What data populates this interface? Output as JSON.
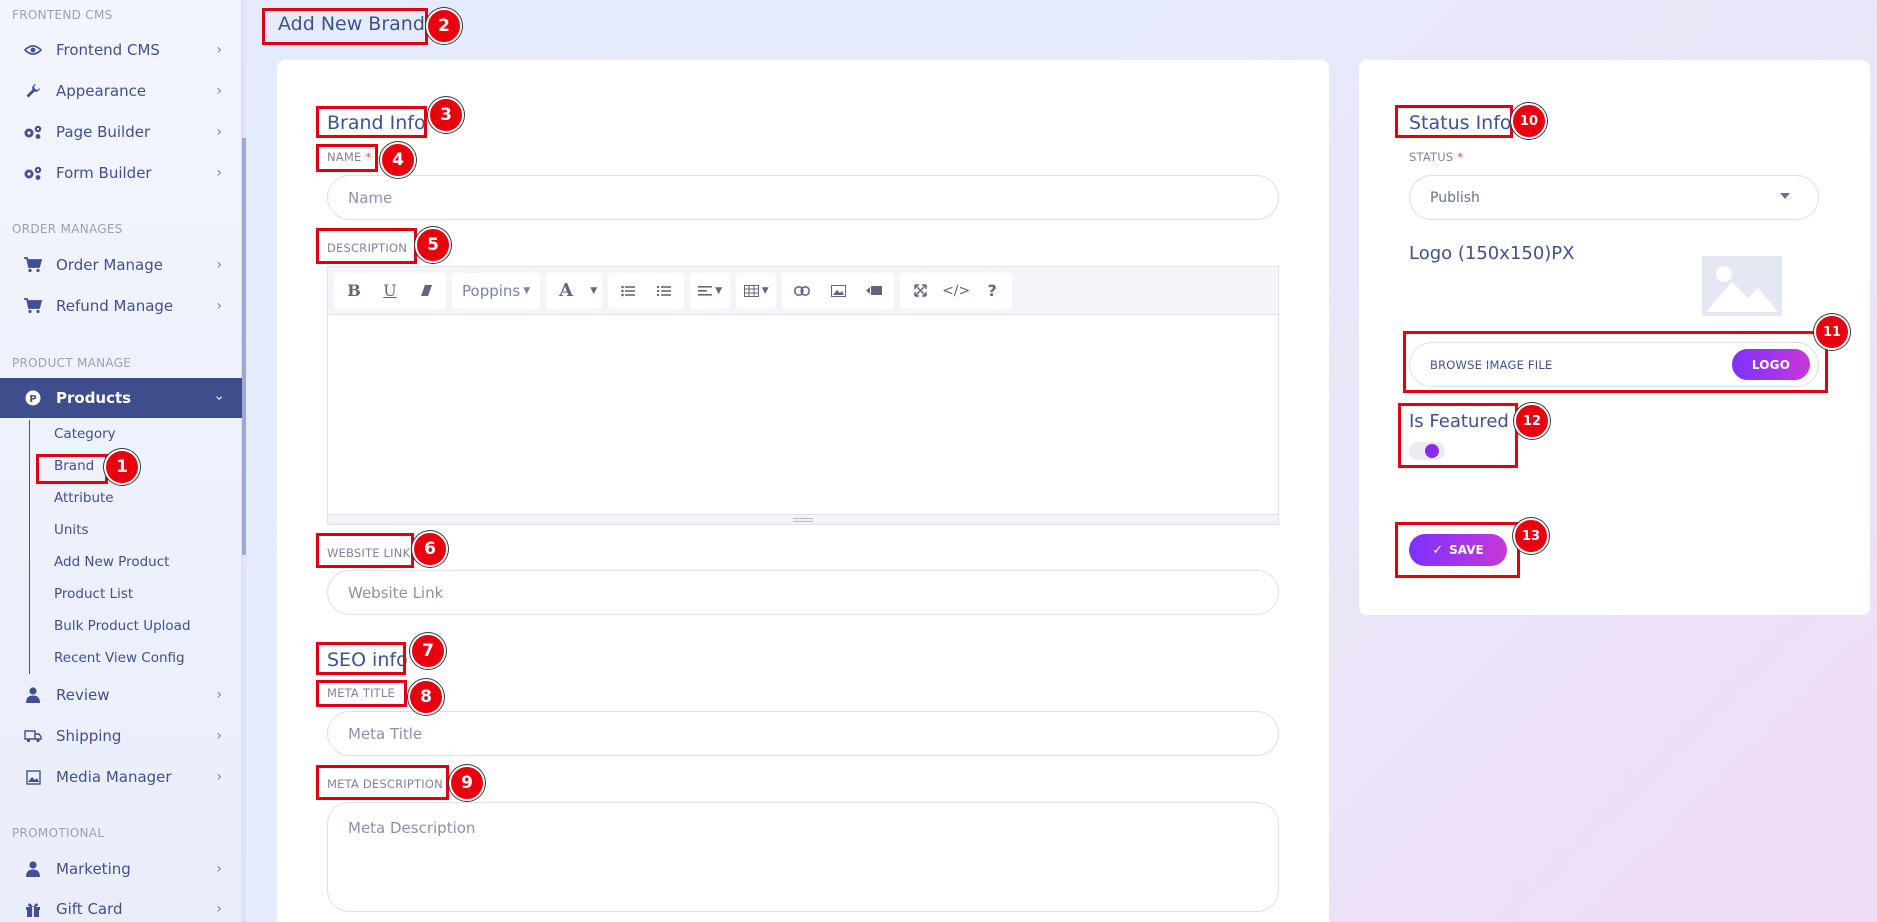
{
  "sidebar": {
    "sections": {
      "frontend": "FRONTEND CMS",
      "order": "ORDER MANAGES",
      "product": "PRODUCT MANAGE",
      "promotional": "PROMOTIONAL"
    },
    "items": {
      "frontend_cms": "Frontend CMS",
      "appearance": "Appearance",
      "page_builder": "Page Builder",
      "form_builder": "Form Builder",
      "order_manage": "Order Manage",
      "refund_manage": "Refund Manage",
      "products": "Products",
      "review": "Review",
      "shipping": "Shipping",
      "media_manager": "Media Manager",
      "marketing": "Marketing",
      "gift_card": "Gift Card"
    },
    "product_sub": {
      "category": "Category",
      "brand": "Brand",
      "attribute": "Attribute",
      "units": "Units",
      "add_new_product": "Add New Product",
      "product_list": "Product List",
      "bulk_product_upload": "Bulk Product Upload",
      "recent_view_config": "Recent View Config"
    }
  },
  "page": {
    "title": "Add New Brand"
  },
  "brand_info": {
    "title": "Brand Info",
    "name_label": "NAME",
    "required_mark": "*",
    "name_placeholder": "Name",
    "description_label": "DESCRIPTION",
    "editor_font": "Poppins",
    "website_label": "WEBSITE LINK",
    "website_placeholder": "Website Link"
  },
  "seo_info": {
    "title": "SEO info",
    "meta_title_label": "META TITLE",
    "meta_title_placeholder": "Meta Title",
    "meta_description_label": "META DESCRIPTION",
    "meta_description_placeholder": "Meta Description"
  },
  "status_info": {
    "title": "Status Info",
    "status_label": "STATUS",
    "required_mark": "*",
    "status_value": "Publish",
    "logo_label": "Logo (150x150)PX",
    "browse_label": "BROWSE IMAGE FILE",
    "logo_button": "LOGO",
    "featured_label": "Is Featured",
    "featured_on": true,
    "save_button": "SAVE",
    "save_check": "✓"
  },
  "annotations": [
    "1",
    "2",
    "3",
    "4",
    "5",
    "6",
    "7",
    "8",
    "9",
    "10",
    "11",
    "12",
    "13"
  ],
  "colors": {
    "primary_text": "#415094",
    "active_nav": "#3f4d8c",
    "gradient_start": "#7c32ff",
    "gradient_end": "#c738d8",
    "annotation_red": "#e0000f"
  }
}
